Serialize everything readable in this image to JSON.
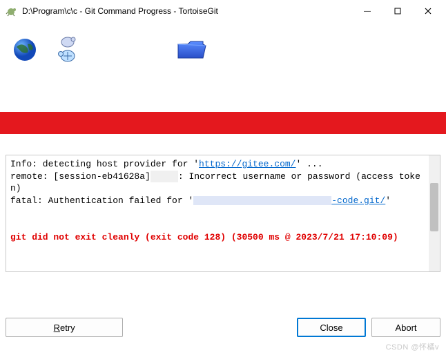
{
  "window": {
    "title": "D:\\Program\\c\\c - Git Command Progress - TortoiseGit",
    "minimize": "—",
    "maximize": "▢",
    "close": "✕"
  },
  "icons": {
    "app": "tortoise-git-icon",
    "globe": "globe-icon",
    "animal": "tortoise-animal-icon",
    "folder": "folder-icon"
  },
  "progress": {
    "bar_color": "#e4181e"
  },
  "log": {
    "line1_prefix": "Info: detecting host provider for '",
    "line1_link": "https://gitee.com/",
    "line1_suffix": "' ...",
    "line2_prefix": "remote: [session-eb41628a]",
    "line2_redacted": "    ",
    "line2_rest": ": Incorrect username or password (access token)",
    "line3_prefix": "fatal: Authentication failed for '",
    "line3_redacted": " ",
    "line3_link_tail": "-code.git/",
    "line3_suffix": "'",
    "blank": "",
    "error": "git did not exit cleanly (exit code 128) (30500 ms @ 2023/7/21 17:10:09)"
  },
  "buttons": {
    "retry_u": "R",
    "retry_rest": "etry",
    "close": "Close",
    "abort": "Abort"
  },
  "watermark": "CSDN @怀橘v"
}
